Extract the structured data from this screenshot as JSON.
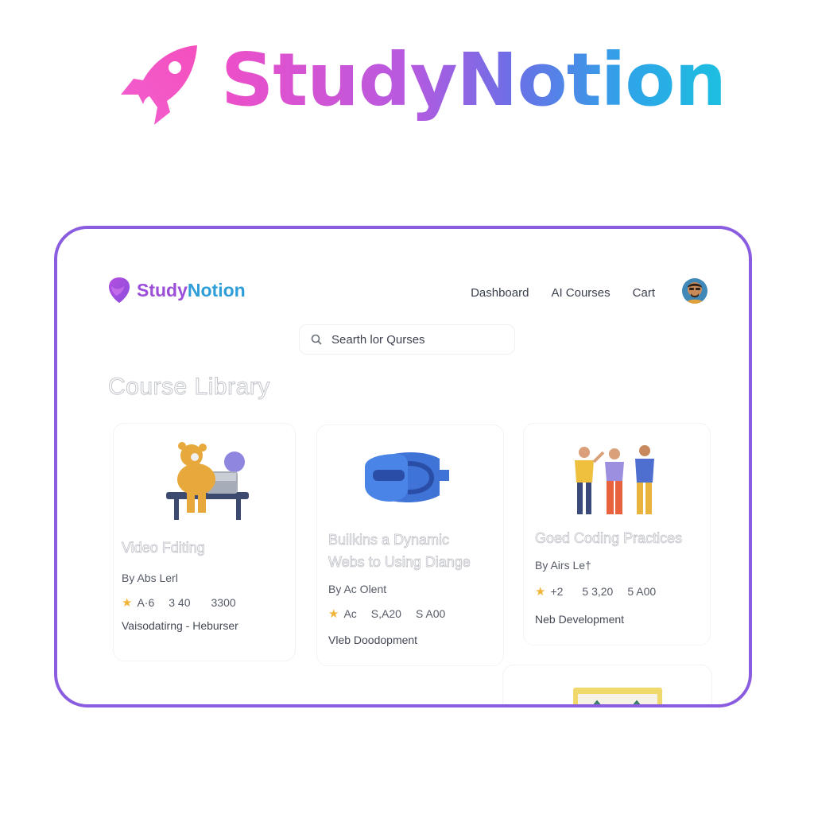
{
  "hero": {
    "brand": "StudyNotion"
  },
  "nav": {
    "brand_part1": "Study",
    "brand_part2": "Notion",
    "links": [
      "Dashboard",
      "AI Courses",
      "Cart"
    ]
  },
  "search": {
    "placeholder": "Searth lor Qurses"
  },
  "library": {
    "title": "Course Library"
  },
  "courses": [
    {
      "title_line1": "Video Fditing",
      "title_line2": "",
      "author": "By Abs Lerl",
      "rating": "A·6",
      "price": "3 40",
      "count": "3300",
      "category": "Vaisodatirng -  Heburser"
    },
    {
      "title_line1": "Builkins a Dynamic",
      "title_line2": "Webs to Using Diange",
      "author": "By Ac Olent",
      "rating": "Ac",
      "price": "S,A20",
      "count": "S A00",
      "category": "Vleb Doodopment"
    },
    {
      "title_line1": "Goed Coding Practices",
      "title_line2": "",
      "author": "By Airs  Le†",
      "rating": "+2",
      "price": "5 3,20",
      "count": "5 A00",
      "category": "Neb Development"
    }
  ],
  "colors": {
    "frame": "#8a5ce0",
    "brand_pink": "#ee4fc8",
    "brand_cyan": "#1cc0e0",
    "star": "#f0b43a"
  }
}
